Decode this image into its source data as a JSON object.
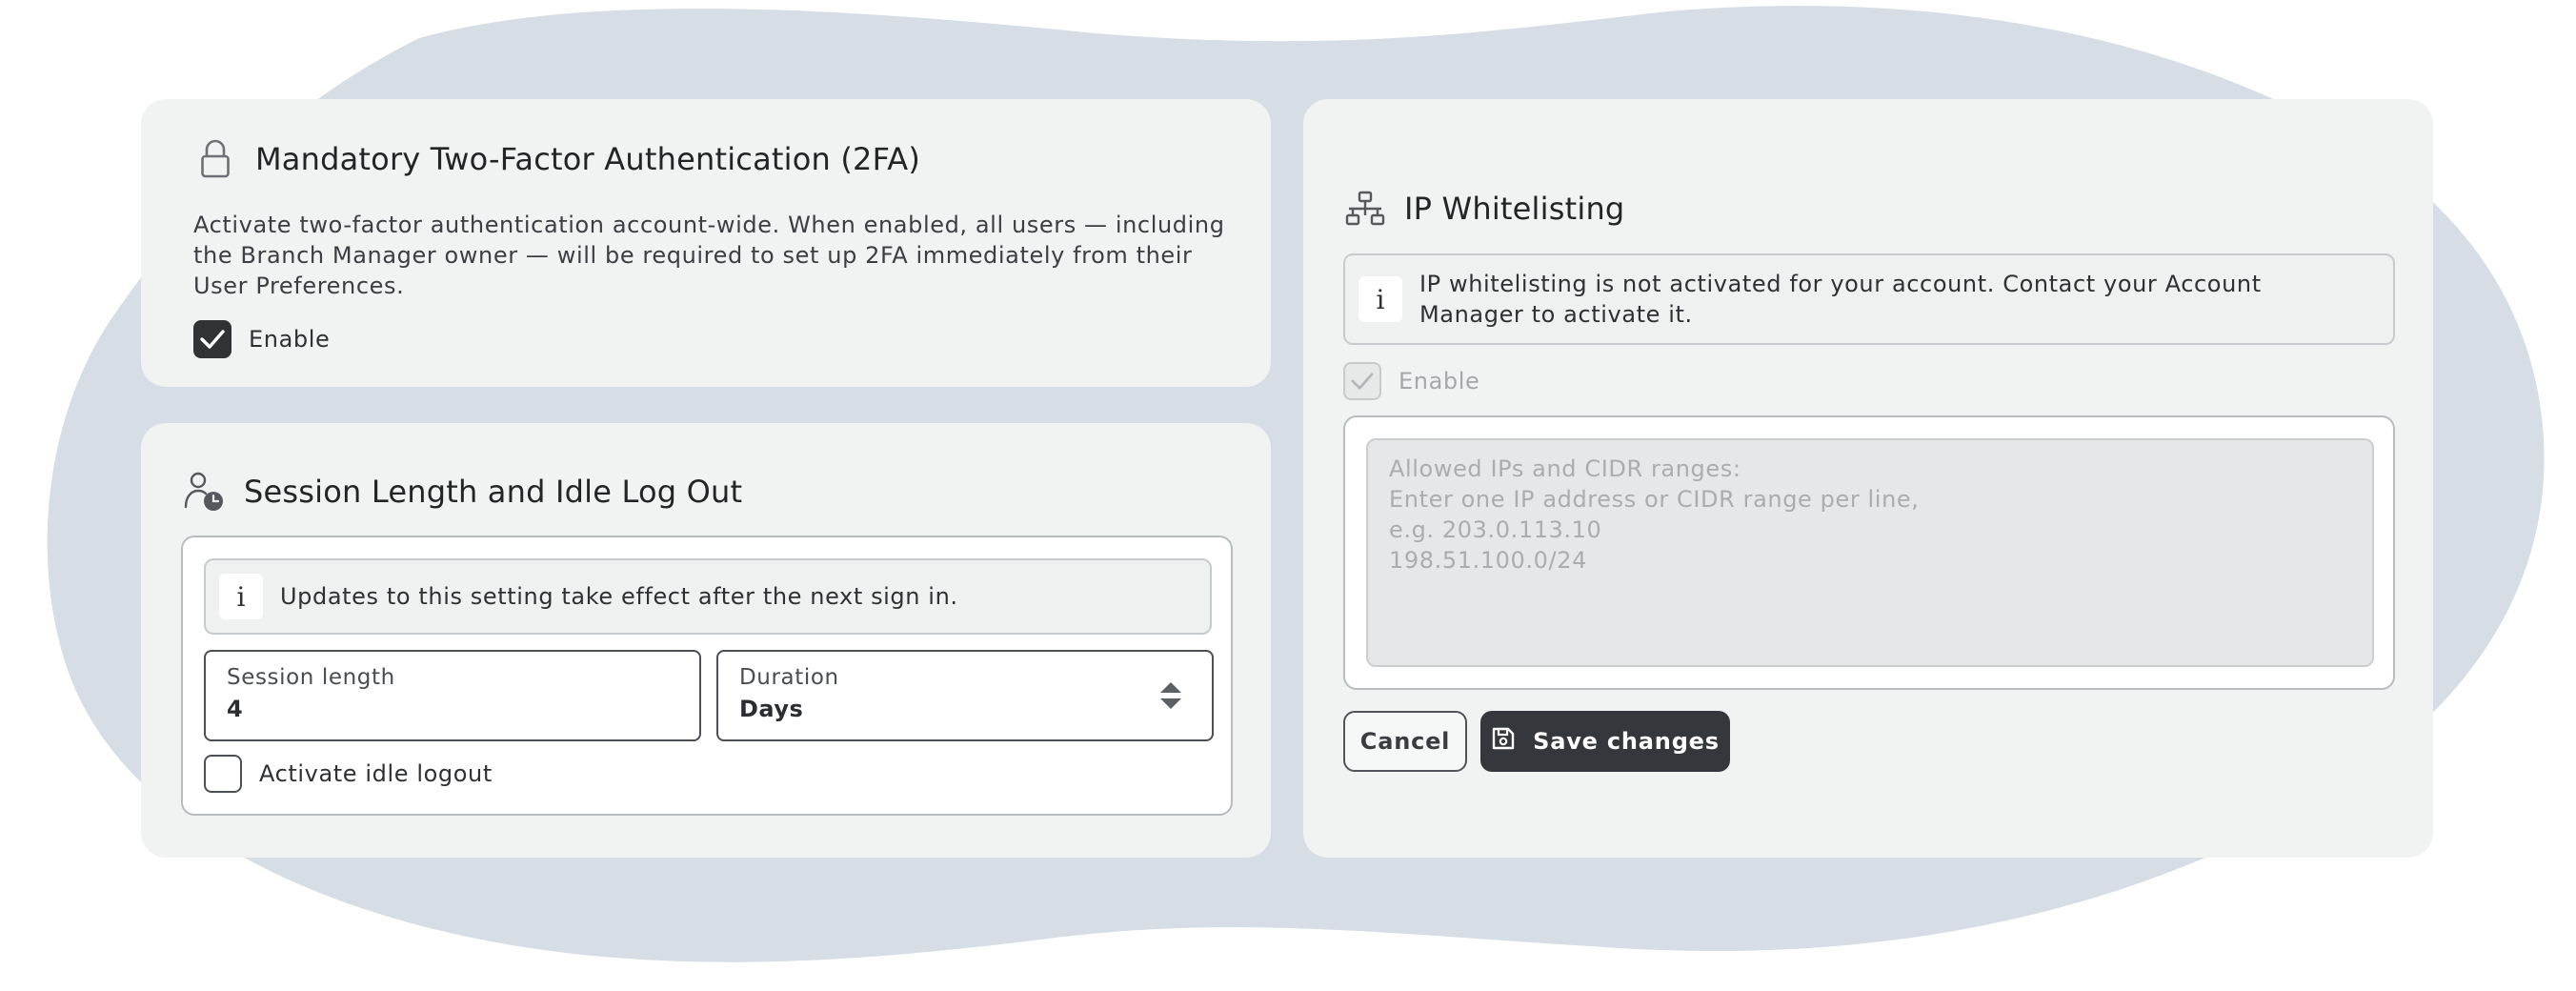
{
  "colors": {
    "blob": "#d6dde5",
    "card": "#f1f2f2",
    "primary_button": "#34373b",
    "checkbox_checked": "#303236"
  },
  "mfa": {
    "icon": "lock-icon",
    "title": "Mandatory Two-Factor Authentication (2FA)",
    "description": "Activate two-factor authentication account-wide. When enabled, all users — including the Branch Manager owner — will be required to set up 2FA immediately from their User Preferences.",
    "enable_label": "Enable",
    "enabled": true
  },
  "session": {
    "icon": "user-clock-icon",
    "title": "Session Length and Idle Log Out",
    "info_text": "Updates to this setting take effect after the next sign in.",
    "length_label": "Session length",
    "length_value": "4",
    "duration_label": "Duration",
    "duration_value": "Days",
    "idle_label": "Activate idle logout",
    "idle_enabled": false
  },
  "ip": {
    "icon": "network-icon",
    "title": "IP Whitelisting",
    "info_text": "IP whitelisting is not activated for your account. Contact your Account Manager to activate it.",
    "enable_label": "Enable",
    "enabled_disabled_state": true,
    "textarea_placeholder": "Allowed IPs and CIDR ranges:\nEnter one IP address or CIDR range per line,\ne.g. 203.0.113.10\n198.51.100.0/24"
  },
  "actions": {
    "cancel_label": "Cancel",
    "save_label": "Save changes"
  }
}
